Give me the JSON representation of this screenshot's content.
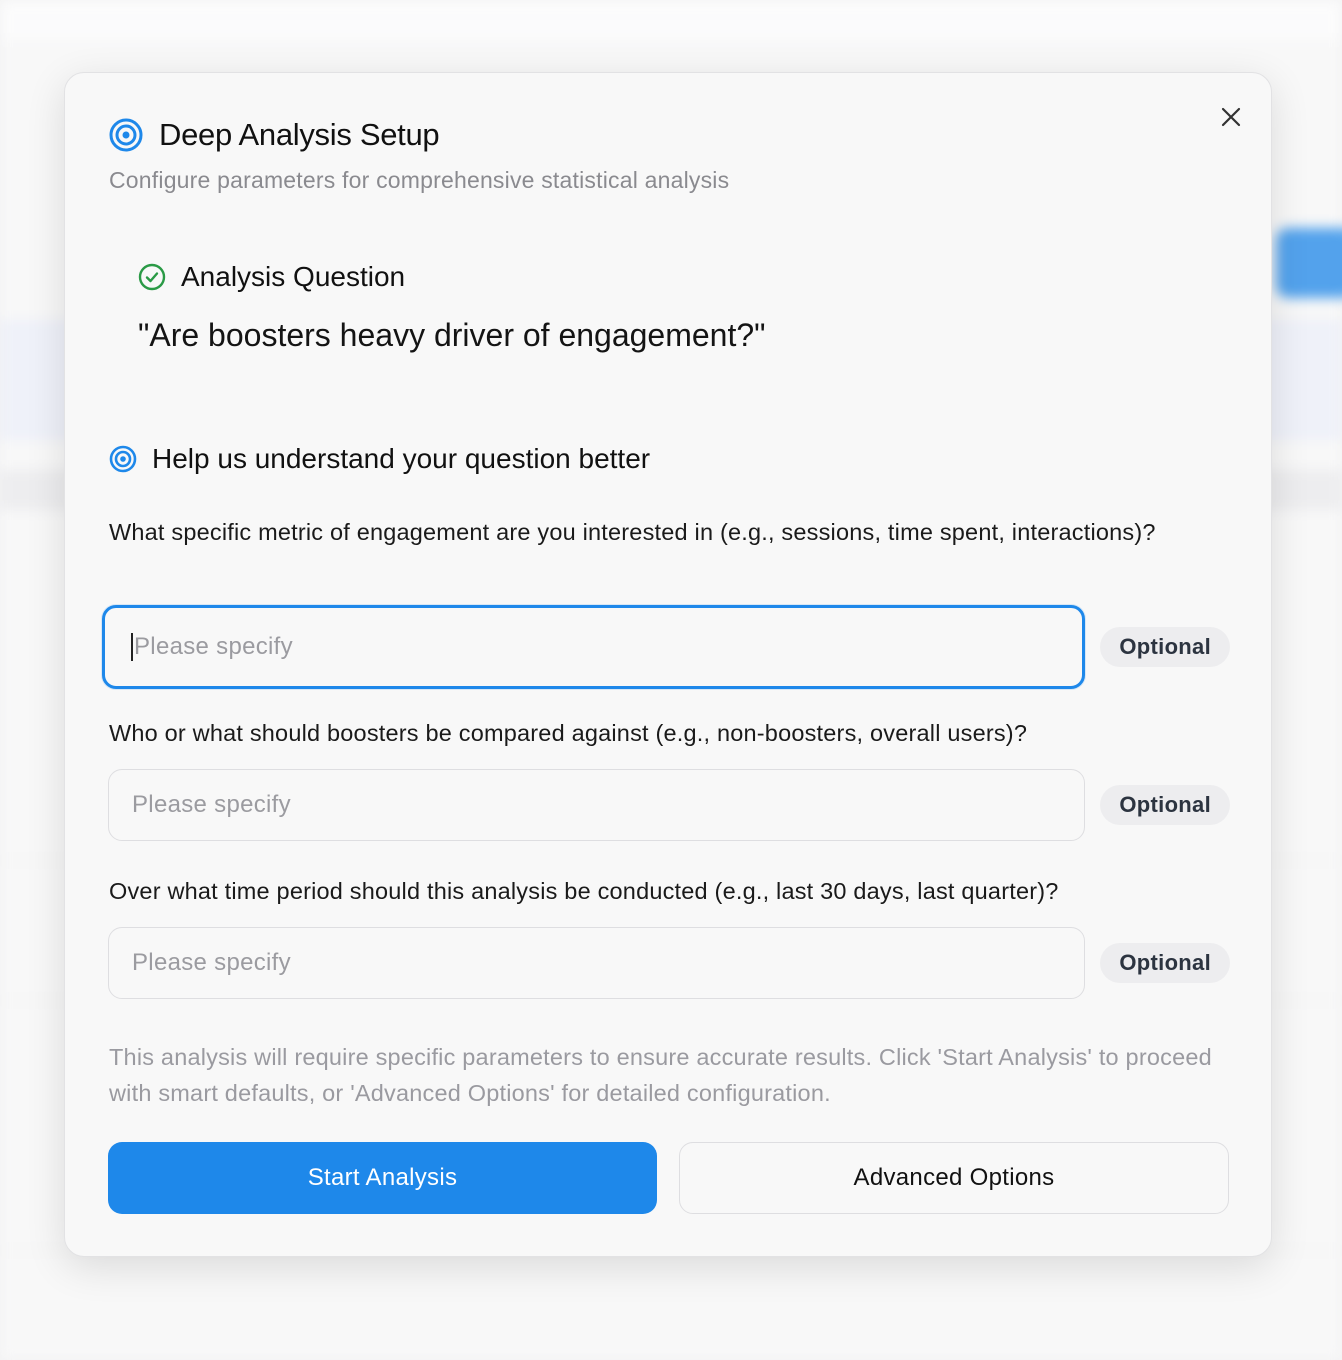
{
  "modal": {
    "title": "Deep Analysis Setup",
    "subtitle": "Configure parameters for comprehensive statistical analysis",
    "close_icon": "close-icon"
  },
  "question": {
    "label": "Analysis Question",
    "text": "\"Are boosters heavy driver of engagement?\""
  },
  "help": {
    "label": "Help us understand your question better"
  },
  "fields": [
    {
      "label": "What specific metric of engagement are you interested in (e.g., sessions, time spent, interactions)?",
      "placeholder": "Please specify",
      "value": "",
      "badge": "Optional"
    },
    {
      "label": "Who or what should boosters be compared against (e.g., non-boosters, overall users)?",
      "placeholder": "Please specify",
      "value": "",
      "badge": "Optional"
    },
    {
      "label": "Over what time period should this analysis be conducted (e.g., last 30 days, last quarter)?",
      "placeholder": "Please specify",
      "value": "",
      "badge": "Optional"
    }
  ],
  "note": "This analysis will require specific parameters to ensure accurate results. Click 'Start Analysis' to proceed with smart defaults, or 'Advanced Options' for detailed configuration.",
  "actions": {
    "primary_label": "Start Analysis",
    "secondary_label": "Advanced Options"
  },
  "colors": {
    "accent": "#1e88ea",
    "success": "#2a9a46",
    "badge_bg": "#ededef"
  }
}
